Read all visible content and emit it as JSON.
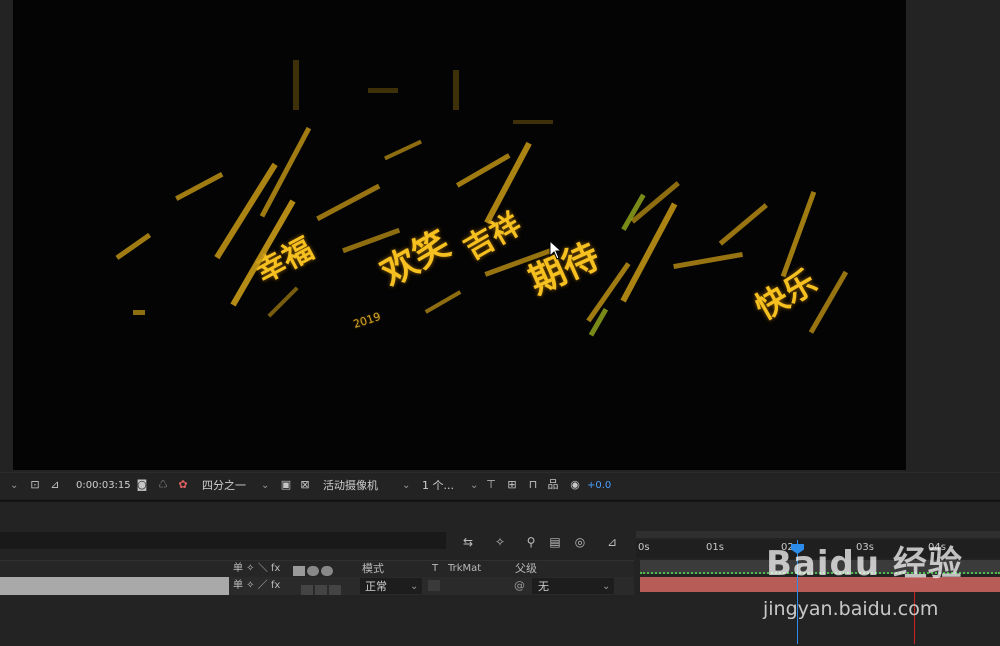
{
  "viewer": {
    "canvas_words": {
      "big": [
        "幸福",
        "欢笑",
        "吉祥",
        "期待",
        "快乐"
      ],
      "year": "2019"
    },
    "toolbar": {
      "timecode": "0:00:03:15",
      "resolution": "四分之一",
      "camera": "活动摄像机",
      "views": "1 个...",
      "exposure": "+0.0"
    }
  },
  "timeline": {
    "columns": {
      "mode": "模式",
      "t": "T",
      "trkmat": "TrkMat",
      "parent": "父级",
      "switches": "单 ✧ ＼ fx"
    },
    "layer": {
      "mode": "正常",
      "parent": "无",
      "switches": "单 ✧ ／ fx"
    },
    "ruler": [
      "0s",
      "01s",
      "02s",
      "03s",
      "04s"
    ]
  },
  "watermark": {
    "logo": "Baidu 经验",
    "url": "jingyan.baidu.com"
  },
  "colors": {
    "text_gold": "#f5c020",
    "playhead": "#2d8ceb",
    "track_clip": "#b75c57",
    "end_marker": "#cc2222",
    "exposure_blue": "#4a9fff"
  }
}
